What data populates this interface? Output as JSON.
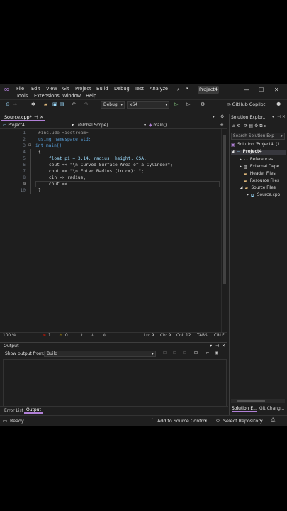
{
  "menu": {
    "items": [
      "File",
      "Edit",
      "View",
      "Git",
      "Project",
      "Build",
      "Debug",
      "Test",
      "Analyze",
      "Tools",
      "Extensions",
      "Window",
      "Help"
    ],
    "project_badge": "Project4"
  },
  "toolbar": {
    "config": "Debug",
    "platform": "x64",
    "copilot": "GitHub Copilot"
  },
  "editor": {
    "tab_label": "Source.cpp*",
    "nav_project": "Project4",
    "nav_scope": "(Global Scope)",
    "nav_member": "main()",
    "line_numbers": [
      "1",
      "2",
      "3",
      "4",
      "5",
      "6",
      "7",
      "8",
      "9",
      "10"
    ],
    "lines": [
      "#include <iostream>",
      "using namespace std;",
      "int main()",
      "{",
      "    float pi = 3.14, radius, height, CSA;",
      "    cout << \"\\n Curved Surface Area of a Cylinder\";",
      "    cout << \"\\n Enter Radius (in cm): \";",
      "    cin >> radius;",
      "    cout <<",
      "}"
    ]
  },
  "status_row": {
    "zoom": "100 %",
    "errors": "1",
    "warnings": "0",
    "ln": "Ln: 9",
    "ch": "Ch: 9",
    "col": "Col: 12",
    "tabs": "TABS",
    "eol": "CRLF"
  },
  "output": {
    "title": "Output",
    "show_from_label": "Show output from:",
    "source": "Build"
  },
  "bottom_tabs": [
    "Error List",
    "Output"
  ],
  "solution_explorer": {
    "title": "Solution Explor...",
    "search_placeholder": "Search Solution Exp",
    "items": [
      "Solution 'Project4' (1",
      "Project4",
      "References",
      "External Depe",
      "Header Files",
      "Resource Files",
      "Source Files",
      "Source.cpp"
    ],
    "tabs": [
      "Solution E...",
      "Git Chang..."
    ]
  },
  "statusbar": {
    "ready": "Ready",
    "source_control": "Add to Source Control",
    "repository": "Select Repository"
  },
  "colors": {
    "accent": "#b180d7",
    "keyword": "#569cd6",
    "string": "#d69d85",
    "error": "#e51400"
  }
}
